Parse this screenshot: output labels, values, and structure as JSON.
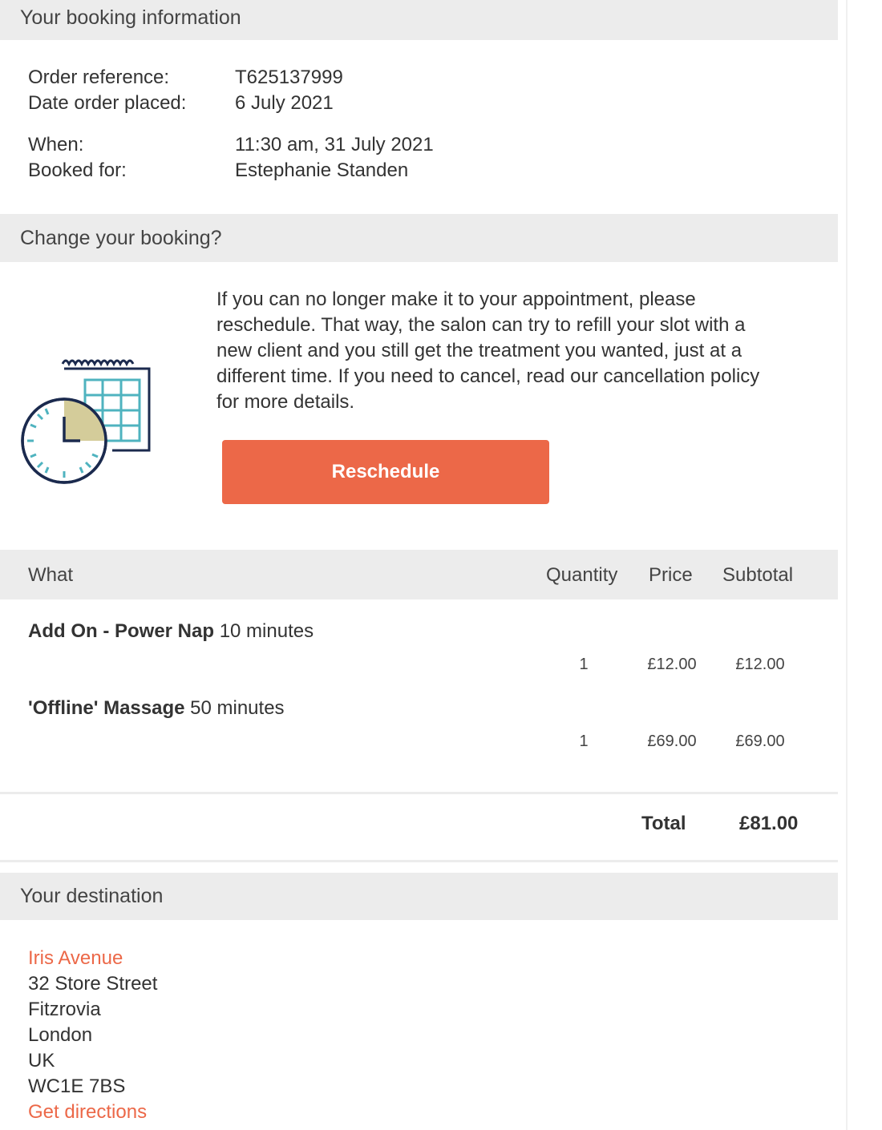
{
  "booking_info": {
    "header": "Your booking information",
    "order_reference_label": "Order reference:",
    "order_reference_value": "T625137999",
    "date_placed_label": "Date order placed:",
    "date_placed_value": "6 July 2021",
    "when_label": "When:",
    "when_value": "11:30 am, 31 July 2021",
    "booked_for_label": "Booked for:",
    "booked_for_value": "Estephanie Standen"
  },
  "change_booking": {
    "header": "Change your booking?",
    "text": "If you can no longer make it to your appointment, please reschedule. That way, the salon can try to refill your slot with a new client and you still get the treatment you wanted, just at a different time. If you need to cancel, read our cancellation policy for more details.",
    "button_label": "Reschedule",
    "icon": "calendar-clock-icon"
  },
  "order_table": {
    "columns": {
      "what": "What",
      "quantity": "Quantity",
      "price": "Price",
      "subtotal": "Subtotal"
    },
    "items": [
      {
        "name": "Add On - Power Nap",
        "duration": "10 minutes",
        "quantity": "1",
        "price": "£12.00",
        "subtotal": "£12.00"
      },
      {
        "name": "'Offline' Massage",
        "duration": "50 minutes",
        "quantity": "1",
        "price": "£69.00",
        "subtotal": "£69.00"
      }
    ],
    "total_label": "Total",
    "total_value": "£81.00"
  },
  "destination": {
    "header": "Your destination",
    "venue_name": "Iris Avenue",
    "address_lines": [
      "32 Store Street",
      "Fitzrovia",
      "London",
      "UK",
      "WC1E 7BS"
    ],
    "directions_link": "Get directions"
  },
  "colors": {
    "accent": "#ec6848",
    "header_bg": "#ececec",
    "icon_navy": "#1b2a4e",
    "icon_teal": "#4fb3bf",
    "icon_khaki": "#d4cc9a"
  }
}
